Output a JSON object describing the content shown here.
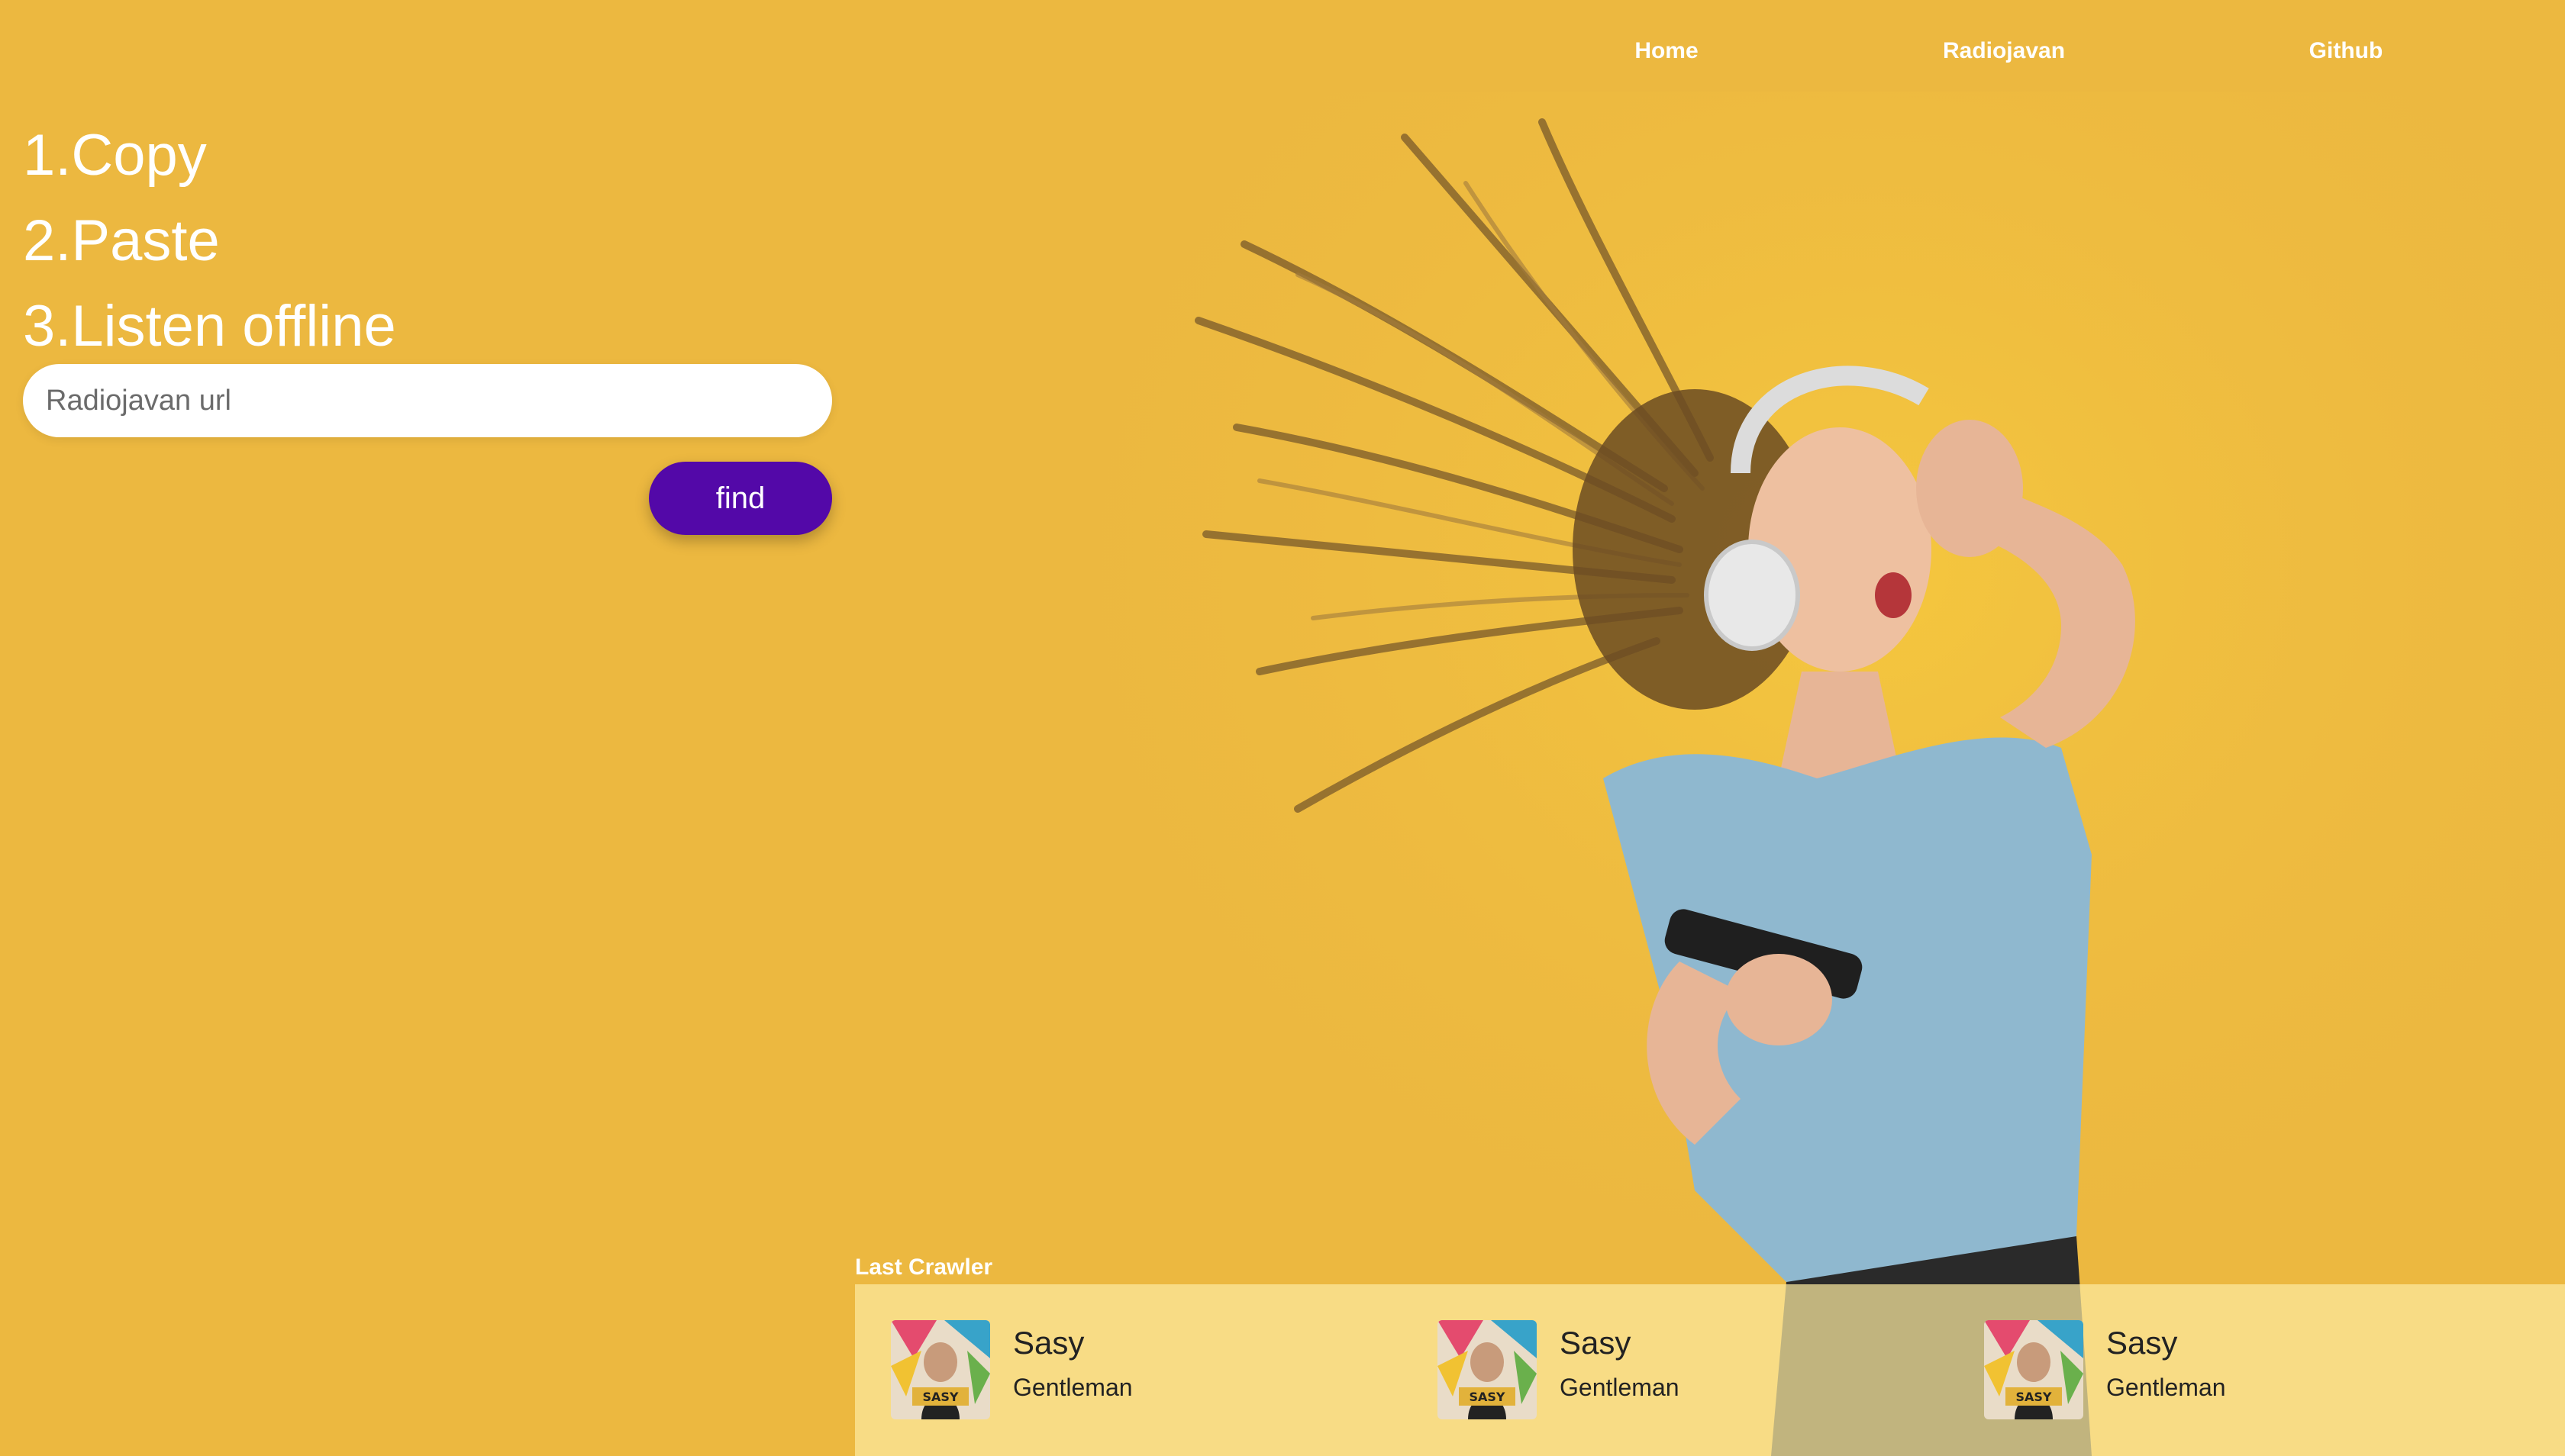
{
  "colors": {
    "background": "#ecb840",
    "button": "#5308a8",
    "panel": "#fcea9f",
    "shirt": "#8fb8cf"
  },
  "nav": {
    "items": [
      {
        "label": "Home"
      },
      {
        "label": "Radiojavan"
      },
      {
        "label": "Github"
      }
    ]
  },
  "steps": [
    {
      "label": "1.Copy"
    },
    {
      "label": "2.Paste"
    },
    {
      "label": "3.Listen offline"
    }
  ],
  "search": {
    "placeholder": "Radiojavan url",
    "value": ""
  },
  "find_button": {
    "label": "find"
  },
  "last_crawler": {
    "title": "Last Crawler",
    "tracks": [
      {
        "artist": "Sasy",
        "title": "Gentleman",
        "cover_icon": "album-cover-icon"
      },
      {
        "artist": "Sasy",
        "title": "Gentleman",
        "cover_icon": "album-cover-icon"
      },
      {
        "artist": "Sasy",
        "title": "Gentleman",
        "cover_icon": "album-cover-icon"
      }
    ]
  }
}
